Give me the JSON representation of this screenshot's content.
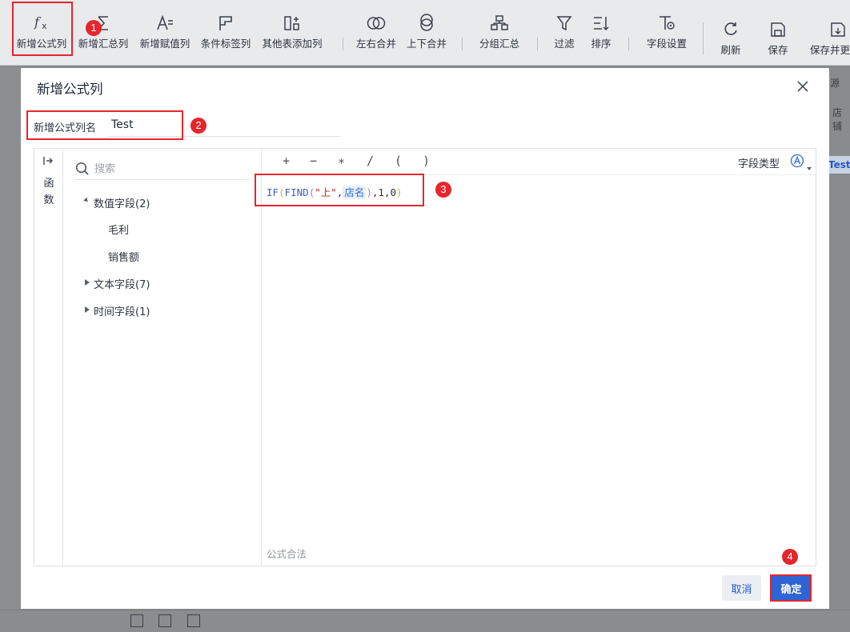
{
  "toolbar": {
    "items": [
      {
        "label": "新增公式列",
        "icon": "fx-icon"
      },
      {
        "label": "新增汇总列",
        "icon": "sigma-icon"
      },
      {
        "label": "新增赋值列",
        "icon": "assign-icon"
      },
      {
        "label": "条件标签列",
        "icon": "flag-icon"
      },
      {
        "label": "其他表添加列",
        "icon": "add-column-icon"
      },
      {
        "label": "左右合并",
        "icon": "merge-horizontal-icon"
      },
      {
        "label": "上下合并",
        "icon": "merge-vertical-icon"
      },
      {
        "label": "分组汇总",
        "icon": "group-icon"
      },
      {
        "label": "过滤",
        "icon": "filter-icon"
      },
      {
        "label": "排序",
        "icon": "sort-icon"
      },
      {
        "label": "字段设置",
        "icon": "field-settings-icon"
      },
      {
        "label": "刷新",
        "icon": "refresh-icon"
      },
      {
        "label": "保存",
        "icon": "save-icon"
      },
      {
        "label": "保存并更",
        "icon": "save-update-icon"
      }
    ]
  },
  "background": {
    "right_text_1": "源",
    "right_text_2": "店铺",
    "chip": "Test"
  },
  "dialog": {
    "title": "新增公式列",
    "name_label": "新增公式列名",
    "name_value": "Test",
    "fn_tab": "函数",
    "search_placeholder": "搜索",
    "tree": [
      {
        "label": "数值字段(2)",
        "expanded": true,
        "children": [
          "毛利",
          "销售额"
        ]
      },
      {
        "label": "文本字段(7)",
        "expanded": false
      },
      {
        "label": "时间字段(1)",
        "expanded": false
      }
    ],
    "operators": [
      "+",
      "−",
      "∗",
      "/",
      "(",
      ")"
    ],
    "field_type_label": "字段类型",
    "formula": {
      "fn1": "IF",
      "fn2": "FIND",
      "string": "\"上\"",
      "field": "店名",
      "tail": ",1,0"
    },
    "formula_status": "公式合法",
    "cancel_label": "取消",
    "ok_label": "确定"
  },
  "annotations": [
    "1",
    "2",
    "3",
    "4"
  ],
  "colors": {
    "accent": "#2f64d6",
    "annotation": "#e5262b",
    "field_token": "#2f6bd4"
  }
}
